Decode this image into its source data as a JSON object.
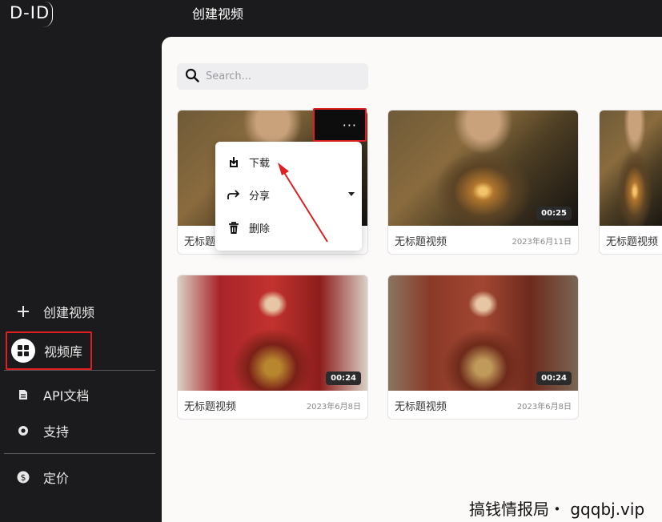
{
  "brand": {
    "logo_text": "D-ID"
  },
  "header": {
    "title": "创建视频"
  },
  "sidebar": {
    "create_label": "创建视频",
    "library_label": "视频库",
    "api_label": "API文档",
    "support_label": "支持",
    "pricing_label": "定价"
  },
  "search": {
    "placeholder": "Search..."
  },
  "videos": [
    {
      "name": "无标题",
      "date": "",
      "duration": ""
    },
    {
      "name": "无标题视频",
      "date": "2023年6月11日",
      "duration": "00:25"
    },
    {
      "name": "无标题视频",
      "date": "",
      "duration": ""
    },
    {
      "name": "无标题视频",
      "date": "2023年6月8日",
      "duration": "00:24"
    },
    {
      "name": "无标题视频",
      "date": "2023年6月8日",
      "duration": "00:24"
    }
  ],
  "context_menu": {
    "more_label": "···",
    "download": "下载",
    "share": "分享",
    "delete": "删除"
  },
  "watermark": "搞钱情报局・ gqqbj.vip",
  "colors": {
    "highlight": "#e02020",
    "sidebar_bg": "#1b1b1d",
    "panel_bg": "#fbfaf9"
  }
}
